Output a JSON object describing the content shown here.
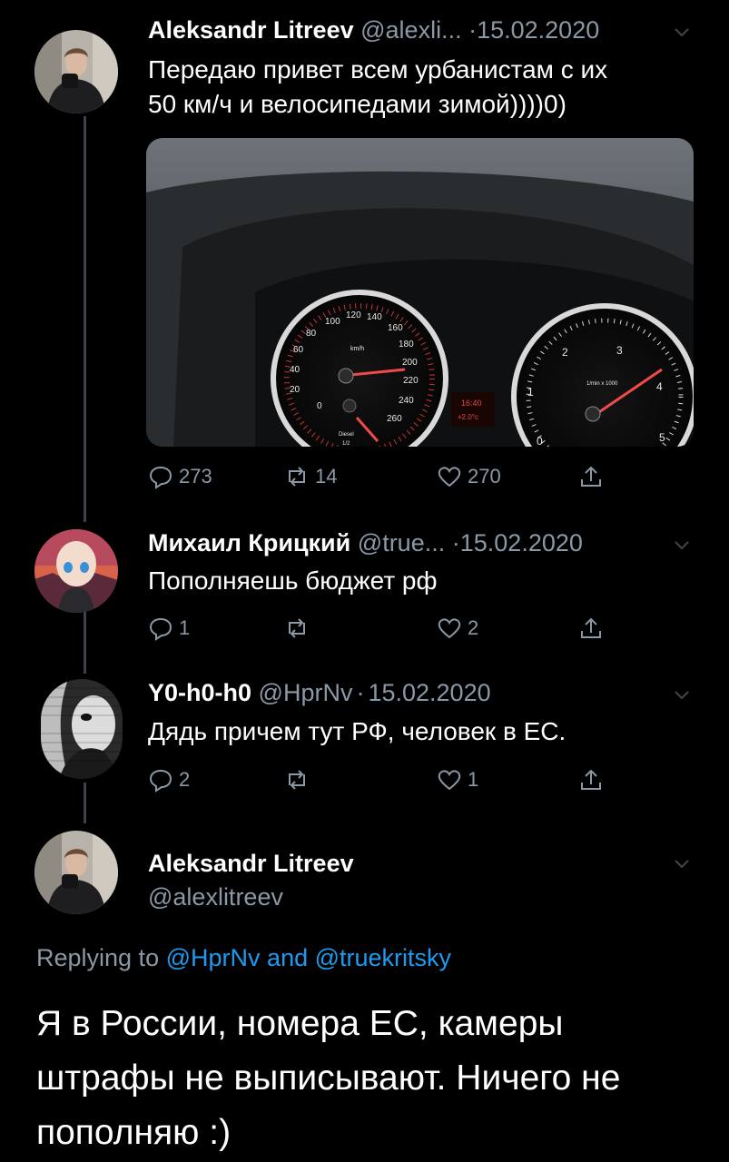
{
  "tweets": [
    {
      "name": "Aleksandr Litreev",
      "handle": "@alexli...",
      "dot": "·",
      "date": "15.02.2020",
      "text_lines": [
        "Передаю привет всем урбанистам с их",
        "50 км/ч и велосипедами зимой))))0)"
      ],
      "media": {
        "speedo_ticks": [
          "0",
          "20",
          "40",
          "60",
          "80",
          "100",
          "120",
          "140",
          "160",
          "180",
          "200",
          "220",
          "240",
          "260"
        ],
        "speedo_unit": "km/h",
        "fuel_label": "Diesel",
        "fuel_fraction": "1/2",
        "clock": "16:40",
        "temp": "+2.0°c",
        "tacho_ticks": [
          "0",
          "1",
          "2",
          "3",
          "4",
          "5"
        ],
        "tacho_unit": "1/min x 1000"
      },
      "replies": "273",
      "retweets": "14",
      "likes": "270"
    },
    {
      "name": "Михаил Крицкий",
      "handle": "@true...",
      "dot": "·",
      "date": "15.02.2020",
      "text_lines": [
        "Пополняешь бюджет рф"
      ],
      "replies": "1",
      "retweets": "",
      "likes": "2"
    },
    {
      "name": "Y0-h0-h0",
      "handle": "@HprNv",
      "dot": "·",
      "date": "15.02.2020",
      "text_lines": [
        "Дядь причем тут РФ, человек в ЕС."
      ],
      "replies": "2",
      "retweets": "",
      "likes": "1"
    }
  ],
  "main_tweet": {
    "name": "Aleksandr Litreev",
    "handle": "@alexlitreev",
    "replying_prefix": "Replying to",
    "mention1": "@HprNv",
    "and": "and",
    "mention2": "@truekritsky",
    "text": "Я в России, номера ЕС, камеры штрафы не выписывают. Ничего не пополняю :)"
  },
  "colors": {
    "background": "#000000",
    "muted": "#8b98a5",
    "link": "#1d9bf0",
    "thread_line": "#3d4248"
  }
}
